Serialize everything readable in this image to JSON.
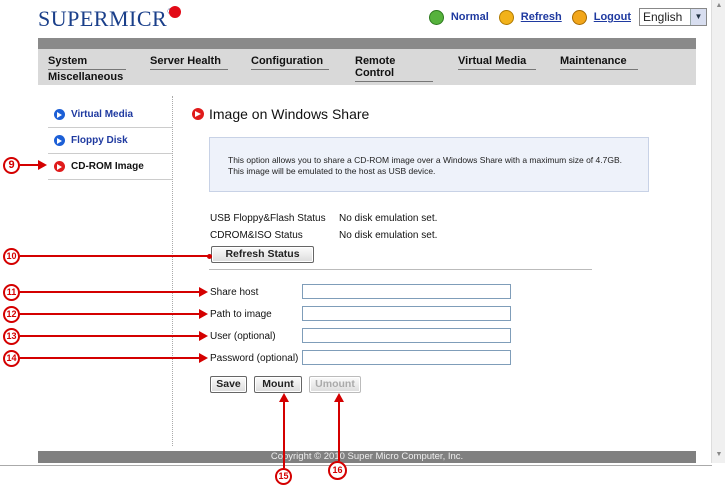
{
  "brand": {
    "logo_text": "SUPERMICR",
    "registered": "®"
  },
  "topbar": {
    "status": "Normal",
    "refresh": "Refresh",
    "logout": "Logout",
    "language": "English",
    "icons": {
      "status": "check-circle-icon",
      "refresh": "refresh-icon",
      "logout": "power-icon"
    }
  },
  "nav": {
    "items": [
      "System",
      "Server Health",
      "Configuration",
      "Remote Control",
      "Virtual Media",
      "Maintenance",
      "Miscellaneous"
    ]
  },
  "sidebar": {
    "items": [
      {
        "label": "Virtual Media"
      },
      {
        "label": "Floppy Disk"
      },
      {
        "label": "CD-ROM Image",
        "active": true
      }
    ]
  },
  "main": {
    "title": "Image on Windows Share",
    "info": "This option allows you to share a CD-ROM image over a Windows Share with a maximum size of 4.7GB. This image will be emulated to the host as USB device.",
    "status": [
      {
        "label": "USB Floppy&Flash Status",
        "value": "No disk emulation set."
      },
      {
        "label": "CDROM&ISO Status",
        "value": "No disk emulation set."
      }
    ],
    "refresh_button": "Refresh Status",
    "fields": [
      {
        "label": "Share host",
        "value": ""
      },
      {
        "label": "Path to image",
        "value": ""
      },
      {
        "label": "User (optional)",
        "value": ""
      },
      {
        "label": "Password (optional)",
        "value": ""
      }
    ],
    "buttons": {
      "save": "Save",
      "mount": "Mount",
      "umount": "Umount"
    }
  },
  "footer": {
    "copyright": "Copyright © 2010 Super Micro Computer, Inc."
  },
  "callouts": [
    "9",
    "10",
    "11",
    "12",
    "13",
    "14",
    "15",
    "16"
  ],
  "colors": {
    "brand": "#1a3f8a",
    "accent": "#e01b1b",
    "callout": "#d40000",
    "link": "#1f3aa0"
  }
}
